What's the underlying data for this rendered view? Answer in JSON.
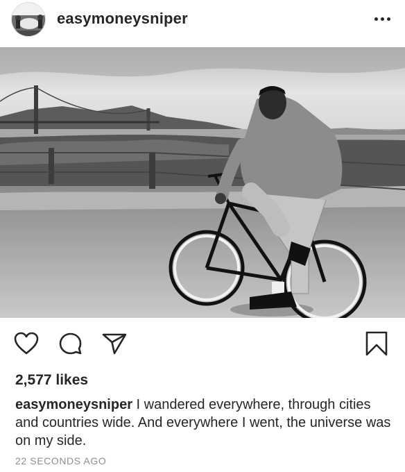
{
  "post": {
    "username": "easymoneysniper",
    "likes": "2,577 likes",
    "caption_username": "easymoneysniper",
    "caption_text": "I wandered everywhere, through cities and countries wide. And everywhere I went, the universe was on my side.",
    "timestamp": "22 SECONDS AGO"
  },
  "icons": {
    "more": "more-options-icon",
    "like": "heart-icon",
    "comment": "comment-icon",
    "share": "share-icon",
    "save": "bookmark-icon"
  },
  "colors": {
    "text": "#262626",
    "muted": "#8e8e8e",
    "background": "#ffffff"
  }
}
